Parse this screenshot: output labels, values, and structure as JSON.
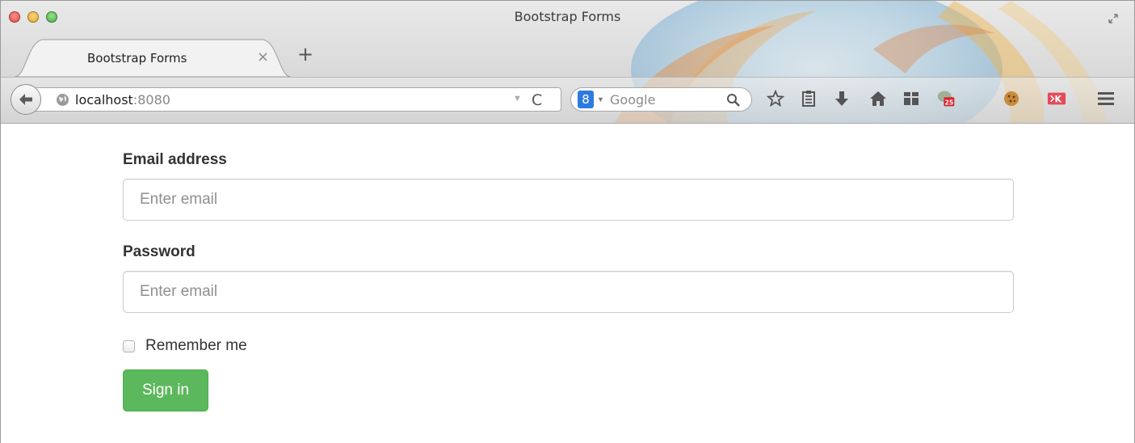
{
  "window": {
    "title": "Bootstrap Forms"
  },
  "tabs": [
    {
      "label": "Bootstrap Forms",
      "close_glyph": "×",
      "active": true
    }
  ],
  "new_tab_glyph": "+",
  "navbar": {
    "url_host": "localhost",
    "url_port": ":8080",
    "reload_glyph": "C",
    "search_engine_badge": "8",
    "search_placeholder": "Google"
  },
  "toolbar_icons": [
    "bookmark-star-icon",
    "reading-list-icon",
    "downloads-icon",
    "home-icon",
    "grid-apps-icon",
    "calendar-extension-icon",
    "cookie-extension-icon",
    "pocket-extension-icon",
    "menu-icon"
  ],
  "calendar_badge": "25",
  "extension_badge": "K",
  "form": {
    "email_label": "Email address",
    "email_placeholder": "Enter email",
    "password_label": "Password",
    "password_placeholder": "Enter email",
    "remember_label": "Remember me",
    "remember_checked": false,
    "submit_label": "Sign in"
  },
  "colors": {
    "success_button": "#5cb85c",
    "input_border": "#cccccc",
    "label_text": "#333333"
  }
}
